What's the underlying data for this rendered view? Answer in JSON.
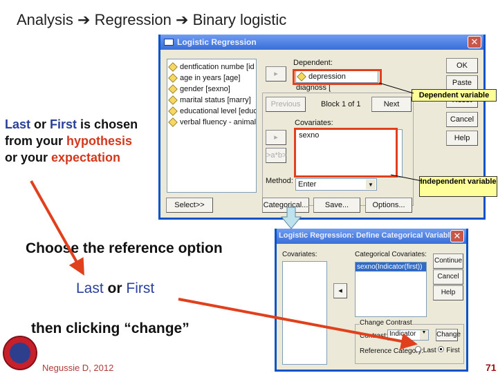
{
  "slide": {
    "title": {
      "a": "Analysis",
      "b": "Regression",
      "c": "Binary logistic"
    },
    "side_text": {
      "p1": "Last",
      "p2": " or ",
      "p3": "First",
      "p4": " is chosen from your ",
      "p5": "hypothesis",
      "p6": " or your ",
      "p7": "expectation"
    },
    "choose": "Choose the reference option",
    "last_first": {
      "a": "Last",
      "b": " or ",
      "c": "First"
    },
    "then_clicking": "then clicking “change”",
    "author": "Negussie D, 2012",
    "page_number": "71"
  },
  "dialog1": {
    "title": "Logistic Regression",
    "variables": [
      "dentfication numbe [id",
      "age in years [age]",
      "gender [sexno]",
      "marital status [marry]",
      "educational level [educ",
      "verbal fluency - animal r"
    ],
    "dependent_label": "Dependent:",
    "dependent_value": "depression diagnoss [",
    "previous": "Previous",
    "block": "Block 1 of 1",
    "next": "Next",
    "covariates_label": "Covariates:",
    "covariate_value": "sexno",
    "interaction": ">a*b>",
    "method_label": "Method:",
    "method_value": "Enter",
    "ok": "OK",
    "paste": "Paste",
    "reset": "Reset",
    "cancel": "Cancel",
    "help": "Help",
    "select": "Select>>",
    "categorical": "Categorical...",
    "save": "Save...",
    "options": "Options..."
  },
  "callouts": {
    "dependent": "Dependent variable",
    "independent": "Independent variable"
  },
  "dialog2": {
    "title": "Logistic Regression: Define Categorical Variables",
    "covariates_label": "Covariates:",
    "categorical_label": "Categorical Covariates:",
    "categorical_value": "sexno(Indicator(first))",
    "continue": "Continue",
    "cancel": "Cancel",
    "help": "Help",
    "change_contrast": "Change Contrast",
    "contrast_label": "Contrast:",
    "contrast_value": "Indicator",
    "change": "Change",
    "reference_label": "Reference Category:",
    "last": "Last",
    "first": "First",
    "selected": "First"
  },
  "colors": {
    "accent_red": "#d4381c",
    "accent_blue": "#2a3f9a",
    "callout": "#ffff99"
  }
}
